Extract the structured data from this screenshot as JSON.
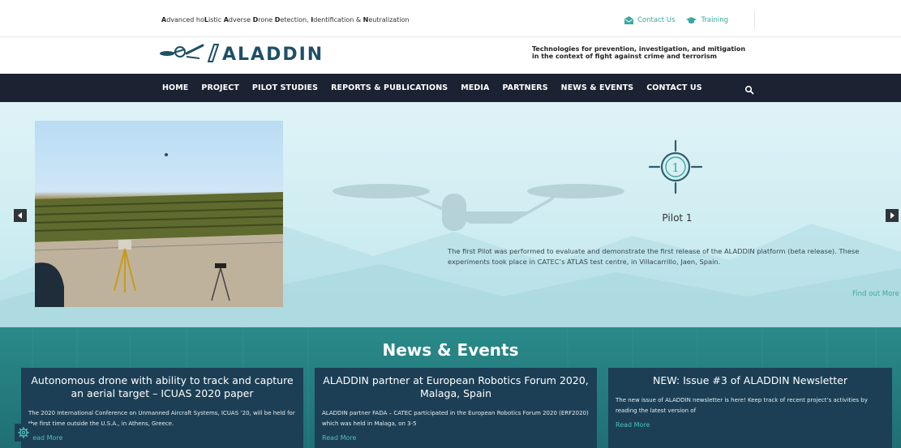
{
  "header": {
    "tagline_parts": [
      {
        "b": "A",
        "t": "dvanced ho"
      },
      {
        "b": "L",
        "t": "istic "
      },
      {
        "b": "A",
        "t": "dverse "
      },
      {
        "b": "D",
        "t": "rone "
      },
      {
        "b": "D",
        "t": "etection, "
      },
      {
        "b": "I",
        "t": "dentification & "
      },
      {
        "b": "N",
        "t": "eutralization"
      }
    ],
    "contact_us": "Contact Us",
    "training": "Training",
    "logo_text": "ALADDIN",
    "slogan_line1": "Technologies for prevention, investigation, and mitigation",
    "slogan_line2": "in the context of fight against crime and terrorism"
  },
  "nav": {
    "items": [
      "HOME",
      "PROJECT",
      "PILOT STUDIES",
      "REPORTS & PUBLICATIONS",
      "MEDIA",
      "PARTNERS",
      "NEWS & EVENTS",
      "CONTACT US"
    ]
  },
  "hero": {
    "pilot_number": "1",
    "pilot_title": "Pilot 1",
    "description": "The first Pilot was performed to evaluate and demonstrate the first release of the ALADDIN platform (beta release). These experiments took place in CATEC’s ATLAS test centre, in Villacarrillo, Jaen, Spain.",
    "find_out": "Find out More"
  },
  "news": {
    "title": "News & Events",
    "cards": [
      {
        "title": "Autonomous drone with ability to track and capture an aerial target – ICUAS 2020 paper",
        "text": "The 2020 International Conference on Unmanned Aircraft Systems, ICUAS ’20, will be held for the first time outside the U.S.A., in Athens, Greece.",
        "more": "Read More"
      },
      {
        "title": "ALADDIN partner at European Robotics Forum 2020, Malaga, Spain",
        "text": "ALADDIN partner FADA – CATEC participated in the European Robotics Forum 2020 (ERF2020) which was held in Malaga, on 3-5",
        "more": "Read More"
      },
      {
        "title": "NEW: Issue #3 of ALADDIN Newsletter",
        "text": "The new issue of ALADDIN newsletter is here! Keep track of recent project’s activities by reading the latest version of",
        "more": "Read More"
      }
    ]
  },
  "colors": {
    "accent": "#3aa8a0",
    "nav_bg": "#1b2232",
    "card_bg": "#1c3f55",
    "logo": "#1e4f66"
  }
}
